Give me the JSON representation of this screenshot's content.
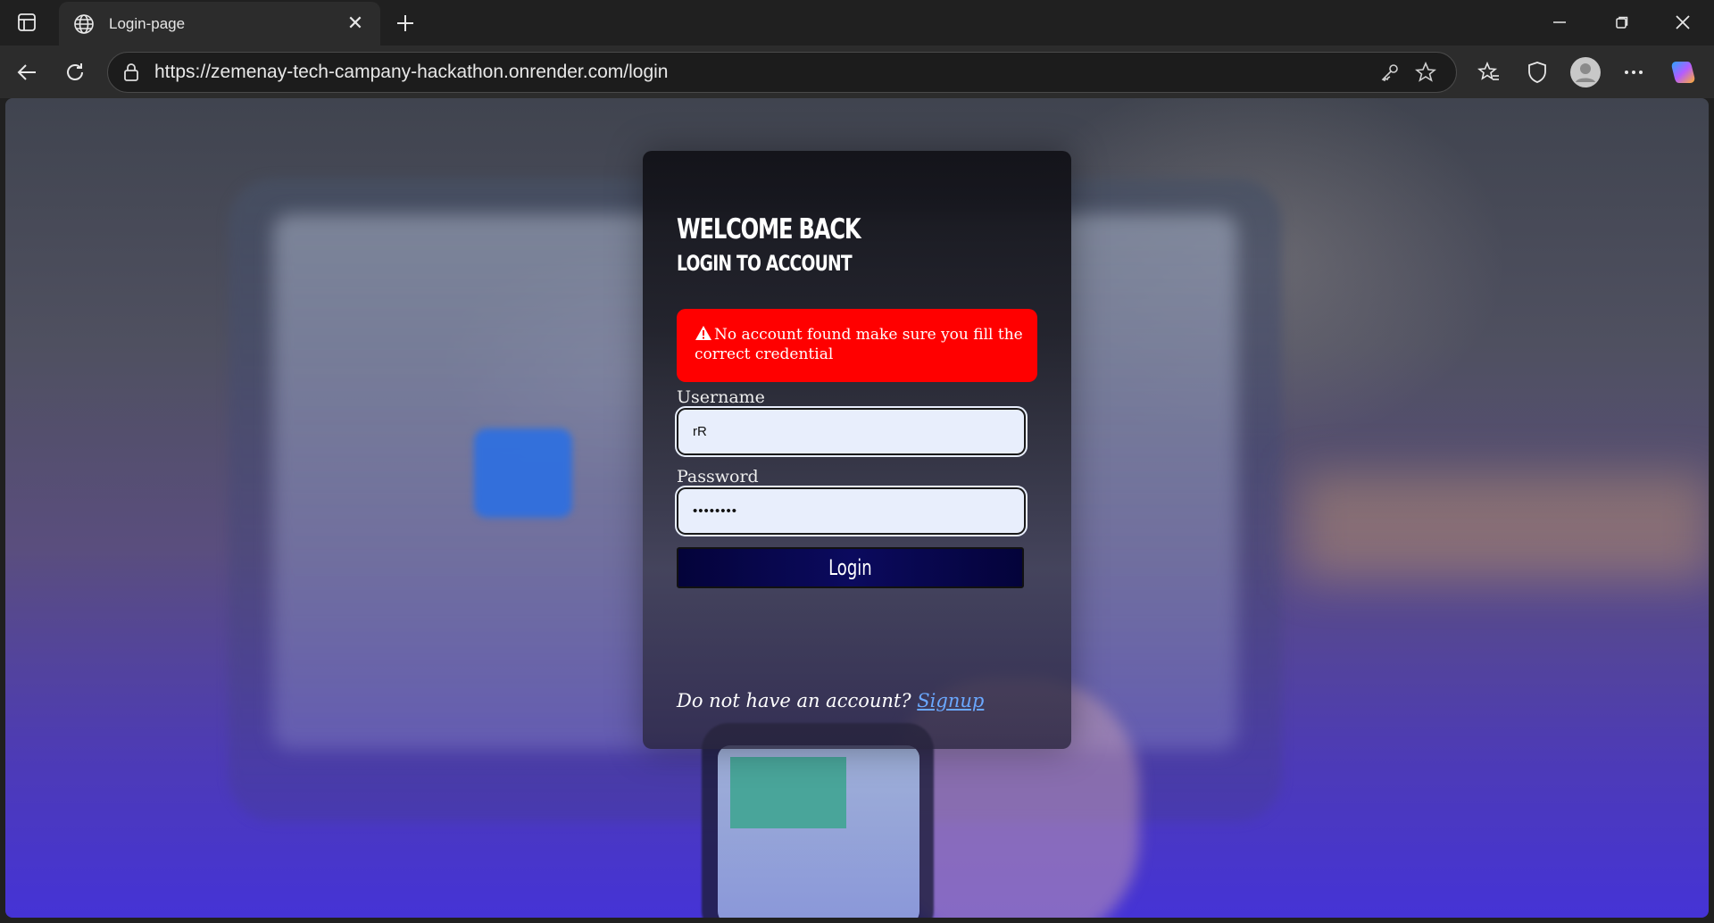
{
  "browser": {
    "tab_title": "Login-page",
    "tab_close": "✕",
    "url": "https://zemenay-tech-campany-hackathon.onrender.com/login"
  },
  "icons": {
    "tab_actions": "tab-actions-icon",
    "globe": "globe-icon",
    "new_tab": "plus-icon",
    "minimize": "minimize-icon",
    "restore": "restore-icon",
    "close": "close-icon",
    "back": "back-arrow-icon",
    "reload": "reload-icon",
    "lock": "lock-icon",
    "key": "key-icon",
    "star": "star-icon",
    "favorites": "favorites-icon",
    "shield": "shield-icon",
    "profile": "profile-icon",
    "more": "more-icon",
    "copilot": "copilot-icon",
    "warning": "warning-icon"
  },
  "login": {
    "heading": "Welcome Back",
    "subheading": "Login to Account",
    "error_message": "No account found make sure you fill the correct credential",
    "username_label": "Username",
    "username_value": "rR",
    "password_label": "Password",
    "password_value": "••••••••",
    "login_button": "Login",
    "signup_prompt": "Do not have an account?",
    "signup_link": "Signup"
  },
  "colors": {
    "error": "#ff0000",
    "button": "#0b0a5e",
    "link": "#6aa8ff"
  }
}
